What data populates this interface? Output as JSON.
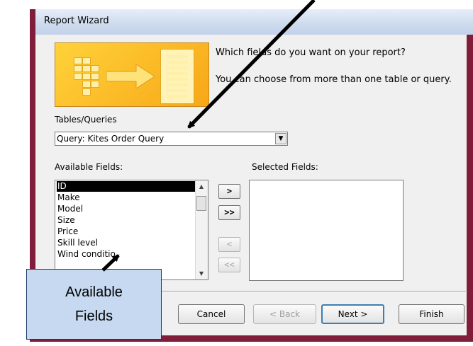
{
  "dialog": {
    "title": "Report Wizard",
    "prompt_fields": "Which fields do you want on your report?",
    "prompt_tables": "You can choose from more than one table or query."
  },
  "tables_queries": {
    "label": "Tables/Queries",
    "value": "Query: Kites Order Query"
  },
  "available_fields": {
    "label": "Available Fields:",
    "items": [
      "ID",
      "Make",
      "Model",
      "Size",
      "Price",
      "Skill level",
      "Wind conditio"
    ],
    "selected": "ID"
  },
  "selected_fields": {
    "label": "Selected Fields:",
    "items": []
  },
  "move_buttons": {
    "add": ">",
    "add_all": ">>",
    "remove": "<",
    "remove_all": "<<"
  },
  "buttons": {
    "cancel": "Cancel",
    "back": "< Back",
    "next": "Next >",
    "finish": "Finish"
  },
  "callout": {
    "line1": "Available",
    "line2": "Fields"
  },
  "colors": {
    "frame": "#7f1d3a",
    "callout_fill": "#c6d9f1",
    "wizard_image": "#f7a717",
    "arrow": "#000000"
  }
}
